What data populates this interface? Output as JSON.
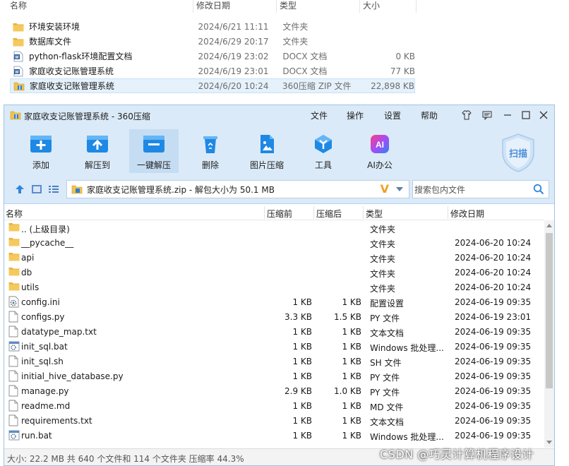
{
  "explorer": {
    "headers": {
      "name": "名称",
      "date": "修改日期",
      "type": "类型",
      "size": "大小"
    },
    "files": [
      {
        "name": "环境安装环境",
        "date": "2024/6/21 11:11",
        "type": "文件夹",
        "size": "",
        "icon": "folder-icon"
      },
      {
        "name": "数据库文件",
        "date": "2024/6/29 20:17",
        "type": "文件夹",
        "size": "",
        "icon": "folder-icon"
      },
      {
        "name": "python-flask环境配置文档",
        "date": "2024/6/19 23:02",
        "type": "DOCX 文档",
        "size": "0 KB",
        "icon": "word-doc-icon"
      },
      {
        "name": "家庭收支记账管理系统",
        "date": "2024/6/19 23:01",
        "type": "DOCX 文档",
        "size": "77 KB",
        "icon": "word-doc-icon"
      },
      {
        "name": "家庭收支记账管理系统",
        "date": "2024/6/20 10:24",
        "type": "360压缩 ZIP 文件",
        "size": "22,898 KB",
        "icon": "zip-archive-icon"
      }
    ]
  },
  "zipwin": {
    "title": "家庭收支记账管理系统 - 360压缩",
    "menu": [
      "文件",
      "操作",
      "设置",
      "帮助"
    ],
    "toolbar": [
      {
        "label": "添加",
        "icon": "add-icon"
      },
      {
        "label": "解压到",
        "icon": "extract-to-icon"
      },
      {
        "label": "一键解压",
        "icon": "one-click-extract-icon"
      },
      {
        "label": "删除",
        "icon": "delete-icon"
      },
      {
        "label": "图片压缩",
        "icon": "image-compress-icon"
      },
      {
        "label": "工具",
        "icon": "tools-icon"
      },
      {
        "label": "AI办公",
        "icon": "ai-office-icon"
      }
    ],
    "scan_label": "扫描",
    "path": "家庭收支记账管理系统.zip - 解包大小为 50.1 MB",
    "path_mark": "V",
    "search_placeholder": "搜索包内文件",
    "columns": {
      "name": "名称",
      "compressed": "压缩前",
      "packed": "压缩后",
      "type": "类型",
      "modified": "修改日期"
    },
    "rows": [
      {
        "name": ".. (上级目录)",
        "before": "",
        "after": "",
        "type": "文件夹",
        "date": "",
        "icon": "folder"
      },
      {
        "name": "__pycache__",
        "before": "",
        "after": "",
        "type": "文件夹",
        "date": "2024-06-20 10:24",
        "icon": "folder"
      },
      {
        "name": "api",
        "before": "",
        "after": "",
        "type": "文件夹",
        "date": "2024-06-20 10:24",
        "icon": "folder"
      },
      {
        "name": "db",
        "before": "",
        "after": "",
        "type": "文件夹",
        "date": "2024-06-20 10:24",
        "icon": "folder"
      },
      {
        "name": "utils",
        "before": "",
        "after": "",
        "type": "文件夹",
        "date": "2024-06-20 10:24",
        "icon": "folder"
      },
      {
        "name": "config.ini",
        "before": "1 KB",
        "after": "1 KB",
        "type": "配置设置",
        "date": "2024-06-19 09:35",
        "icon": "settings"
      },
      {
        "name": "configs.py",
        "before": "3.3 KB",
        "after": "1.5 KB",
        "type": "PY 文件",
        "date": "2024-06-19 23:01",
        "icon": "file"
      },
      {
        "name": "datatype_map.txt",
        "before": "1 KB",
        "after": "1 KB",
        "type": "文本文档",
        "date": "2024-06-19 09:35",
        "icon": "file"
      },
      {
        "name": "init_sql.bat",
        "before": "1 KB",
        "after": "1 KB",
        "type": "Windows 批处理...",
        "date": "2024-06-19 09:35",
        "icon": "batch"
      },
      {
        "name": "init_sql.sh",
        "before": "1 KB",
        "after": "1 KB",
        "type": "SH 文件",
        "date": "2024-06-19 09:35",
        "icon": "file"
      },
      {
        "name": "initial_hive_database.py",
        "before": "1 KB",
        "after": "1 KB",
        "type": "PY 文件",
        "date": "2024-06-19 09:35",
        "icon": "file"
      },
      {
        "name": "manage.py",
        "before": "2.9 KB",
        "after": "1.0 KB",
        "type": "PY 文件",
        "date": "2024-06-19 09:35",
        "icon": "file"
      },
      {
        "name": "readme.md",
        "before": "1 KB",
        "after": "1 KB",
        "type": "MD 文件",
        "date": "2024-06-19 09:35",
        "icon": "file"
      },
      {
        "name": "requirements.txt",
        "before": "1 KB",
        "after": "1 KB",
        "type": "文本文档",
        "date": "2024-06-19 09:35",
        "icon": "file"
      },
      {
        "name": "run.bat",
        "before": "1 KB",
        "after": "1 KB",
        "type": "Windows 批处理...",
        "date": "2024-06-19 09:35",
        "icon": "batch"
      }
    ],
    "status": "大小: 22.2 MB 共 640 个文件和 114 个文件夹 压缩率 44.3%"
  },
  "watermark": "CSDN @巧灵计算机程序设计",
  "colors": {
    "title_bg": "#dbeaf8",
    "folder": "#f2c24e",
    "accent": "#1e88e5",
    "word": "#2b5797"
  }
}
